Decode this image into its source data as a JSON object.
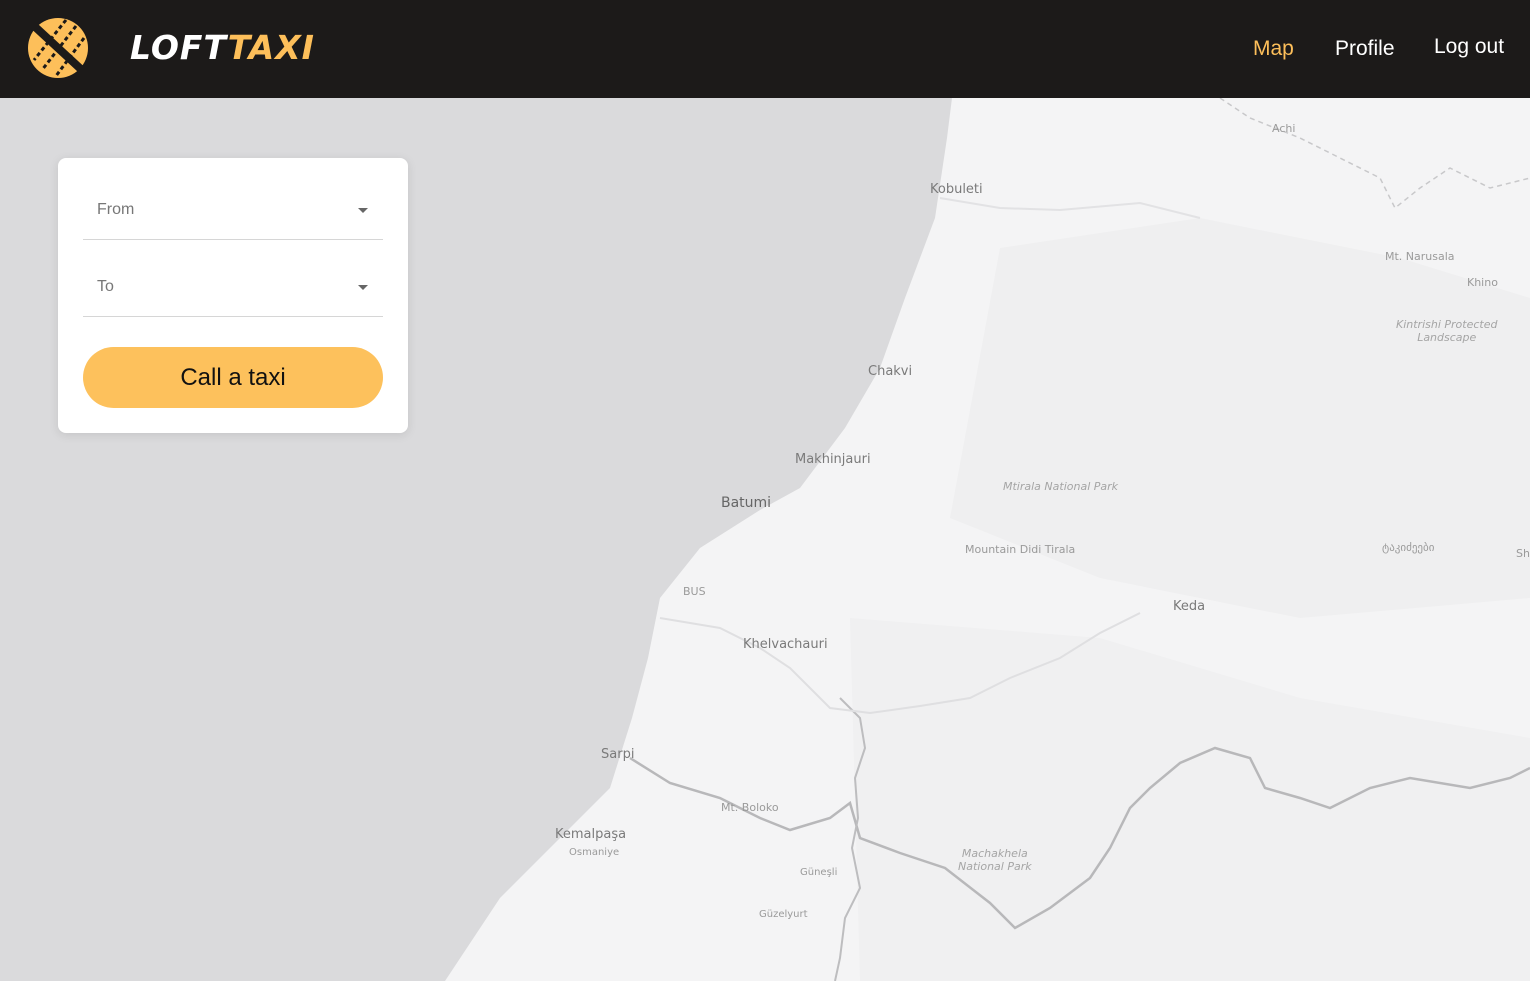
{
  "colors": {
    "header_bg": "#1c1a19",
    "accent": "#fdbf5a",
    "button_bg": "#fdc15c",
    "sea": "#dadadc",
    "land": "#f4f4f5"
  },
  "header": {
    "logo_icon": "taxi-logo-icon",
    "logo_text_white": "LOFT",
    "logo_text_accent": "TAXI",
    "nav": [
      {
        "label": "Map",
        "active": true
      },
      {
        "label": "Profile",
        "active": false
      },
      {
        "label": "Log out",
        "active": false
      }
    ]
  },
  "order_form": {
    "from_placeholder": "From",
    "to_placeholder": "To",
    "call_button_label": "Call a taxi",
    "dropdown_icon": "caret-down-icon"
  },
  "map_labels": [
    {
      "text": "Achi",
      "kind": "small"
    },
    {
      "text": "Kobuleti",
      "kind": "city"
    },
    {
      "text": "Mt. Narusala",
      "kind": "small"
    },
    {
      "text": "Khino",
      "kind": "small"
    },
    {
      "text": "Kintrishi Protected\nLandscape",
      "kind": "park"
    },
    {
      "text": "Chakvi",
      "kind": "city"
    },
    {
      "text": "Makhinjauri",
      "kind": "city"
    },
    {
      "text": "Mtirala National Park",
      "kind": "park"
    },
    {
      "text": "Batumi",
      "kind": "big"
    },
    {
      "text": "Mountain Didi Tirala",
      "kind": "small"
    },
    {
      "text": "ტაკიძეები",
      "kind": "small"
    },
    {
      "text": "Sh",
      "kind": "small"
    },
    {
      "text": "BUS",
      "kind": "small"
    },
    {
      "text": "Keda",
      "kind": "city"
    },
    {
      "text": "Khelvachauri",
      "kind": "city"
    },
    {
      "text": "Sarpi",
      "kind": "city"
    },
    {
      "text": "Mt. Boloko",
      "kind": "small"
    },
    {
      "text": "Kemalpaşa",
      "kind": "city"
    },
    {
      "text": "Osmaniye",
      "kind": "small"
    },
    {
      "text": "Machakhela\nNational Park",
      "kind": "park"
    },
    {
      "text": "Güneşli",
      "kind": "small"
    },
    {
      "text": "Güzelyurt",
      "kind": "small"
    }
  ]
}
